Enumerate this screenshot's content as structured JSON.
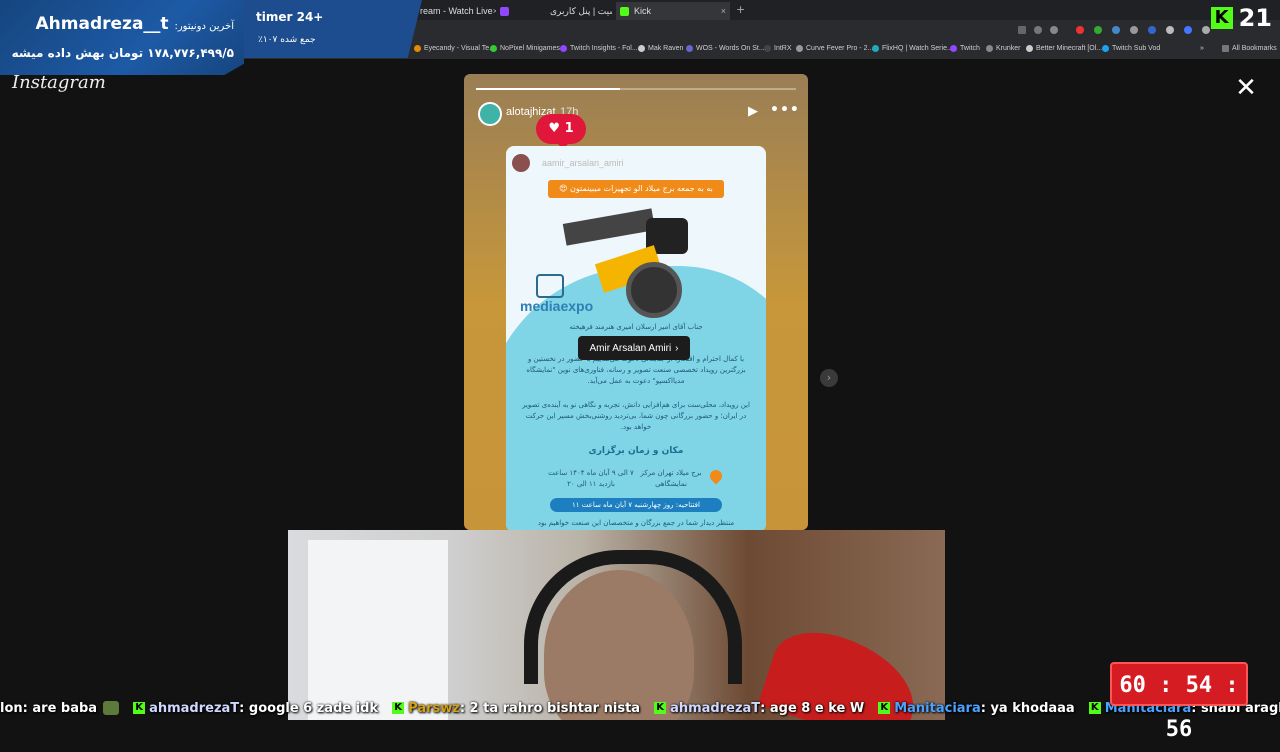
{
  "browser": {
    "tabs": [
      {
        "label": "ream - Watch Live",
        "icon": "twitch-icon"
      },
      {
        "label": "",
        "icon": "twitch-icon"
      },
      {
        "label": "رسیت | پنل کاربری",
        "icon": "page-icon"
      },
      {
        "label": "Kick",
        "icon": "kick-icon"
      }
    ],
    "bookmarks": [
      "Eyecandy - Visual Te...",
      "NoPixel Minigames",
      "Twitch Insights - Fol...",
      "Mak Raven",
      "WOS - Words On St...",
      "IntRX",
      "Curve Fever Pro - 2...",
      "FlixHQ | Watch Serie...",
      "Twitch",
      "Krunker",
      "Better Minecraft [Ol...",
      "Twitch Sub Vod"
    ],
    "all_bookmarks": "All Bookmarks"
  },
  "donation": {
    "label": "آخرین دونیتور:",
    "name": "Ahmadreza__t",
    "amount_text": "۱۷۸,۷۷۶,۴۹۹/۵ تومان بهش داده میشه",
    "timer": "timer 24+",
    "collected": "٪۱۰۷ جمع شده"
  },
  "kick": {
    "viewer_count": "21"
  },
  "instagram": {
    "logo": "Instagram",
    "close": "✕",
    "story": {
      "username": "alotajhizat",
      "time": "17h",
      "likes": "1",
      "progress_fraction": 0.45,
      "tag_label": "Amir Arsalan Amiri",
      "poster": {
        "repost_user": "aamir_arsalan_amiri",
        "banner": "به به جمعه برج میلاد الو تجهیزات میبینمتون 😍",
        "brand": "mediaexpo",
        "para1": "جناب آقای امیر ارسلان امیری هنرمند فرهیخته",
        "para2": "با کمال احترام و افتخار، از جنابعالی دعوت می‌نماییم با حضور در نخستین و بزرگترین رویداد تخصصی صنعت تصویر و رسانه، فناوری‌های نوین \"نمایشگاه مدیااکسپو\" دعوت به عمل می‌آید.",
        "para3": "این رویداد، محلی‌ست برای هم‌افزایی دانش، تجربه و نگاهی نو به آینده‌ی تصویر در ایران؛ و حضور بزرگانی چون شما، بی‌تردید روشنی‌بخش مسیر این حرکت خواهد بود.",
        "venue_title": "مکان و زمان برگزاری",
        "venue": "برج میلاد تهران مرکز نمایشگاهی",
        "dates": "۷ الی ۹ آبان ماه ۱۴۰۴ ساعت بازدید ۱۱ الی ۲۰",
        "opening": "افتتاحیه: روز چهارشنبه ۷ آبان ماه ساعت ۱۱",
        "footer": "منتظر دیدار شما در جمع بزرگان و متخصصان این صنعت خواهیم بود"
      }
    }
  },
  "chat": [
    {
      "user": "lon",
      "text": ": are baba",
      "color": "#ffffff",
      "emote": true
    },
    {
      "user": "ahmadrezaT",
      "text": ": google 6 zade idk",
      "color": "#cfd8ff"
    },
    {
      "user": "Parswz",
      "text": ": 2 ta rahro bishtar nista",
      "color": "#d4a017"
    },
    {
      "user": "ahmadrezaT",
      "text": ": age 8 e ke W",
      "color": "#cfd8ff"
    },
    {
      "user": "Manitaciara",
      "text": ": ya khodaaa",
      "color": "#4aa3ff"
    },
    {
      "user": "Manitaciara",
      "text": ": shabi araghia shooddddiii",
      "color": "#4aa3ff"
    }
  ],
  "countdown": "60 : 54 : 56"
}
